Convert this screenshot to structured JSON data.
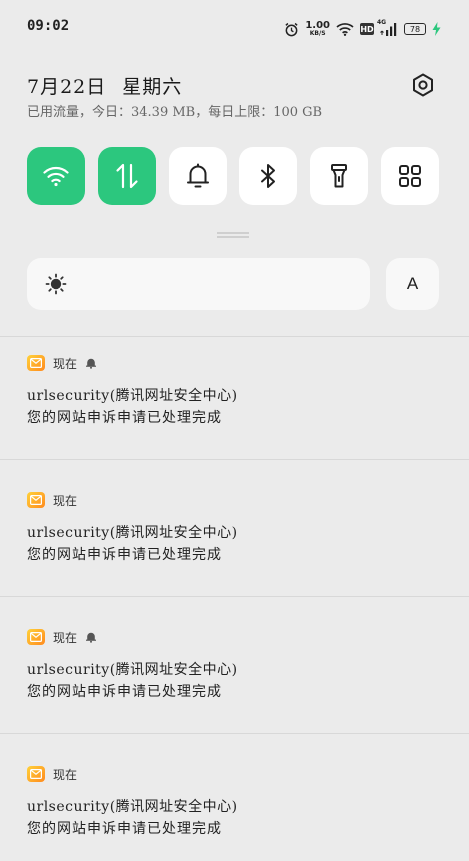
{
  "status_bar": {
    "time": "09:02",
    "net_speed_value": "1.00",
    "net_speed_unit": "KB/S",
    "hd_label": "HD",
    "network_type": "4G",
    "battery_level": "78",
    "icons": [
      "alarm-icon",
      "wifi-icon",
      "hd-icon",
      "cell-signal-icon",
      "battery-icon",
      "charging-icon"
    ]
  },
  "header": {
    "date": "7月22日",
    "weekday": "星期六",
    "data_usage": "已用流量，今日：34.39 MB，每日上限：100 GB"
  },
  "quick_tiles": [
    {
      "name": "wifi",
      "active": true,
      "icon": "wifi-icon"
    },
    {
      "name": "mobile-data",
      "active": true,
      "icon": "data-transfer-icon"
    },
    {
      "name": "sound",
      "active": false,
      "icon": "bell-icon"
    },
    {
      "name": "bluetooth",
      "active": false,
      "icon": "bluetooth-icon"
    },
    {
      "name": "flashlight",
      "active": false,
      "icon": "flashlight-icon"
    },
    {
      "name": "edit-tiles",
      "active": false,
      "icon": "grid-icon"
    }
  ],
  "brightness": {
    "auto_label": "A"
  },
  "colors": {
    "accent_green": "#2cc77e",
    "background": "#ebebeb",
    "tile_bg": "#ffffff",
    "mail_gradient_start": "#ffd23a",
    "mail_gradient_end": "#ff8a1e"
  },
  "notifications": [
    {
      "time": "现在",
      "muted": true,
      "title": "urlsecurity(腾讯网址安全中心)",
      "body": "您的网站申诉申请已处理完成"
    },
    {
      "time": "现在",
      "muted": false,
      "title": "urlsecurity(腾讯网址安全中心)",
      "body": "您的网站申诉申请已处理完成"
    },
    {
      "time": "现在",
      "muted": true,
      "title": "urlsecurity(腾讯网址安全中心)",
      "body": "您的网站申诉申请已处理完成"
    },
    {
      "time": "现在",
      "muted": false,
      "title": "urlsecurity(腾讯网址安全中心)",
      "body": "您的网站申诉申请已处理完成"
    }
  ]
}
